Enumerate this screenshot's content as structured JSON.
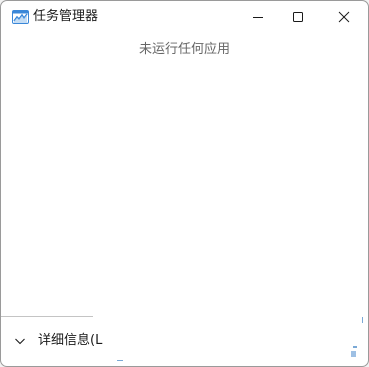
{
  "window": {
    "title": "任务管理器",
    "app_icon": "task-manager-icon"
  },
  "caption_buttons": {
    "minimize_icon": "minimize-icon",
    "maximize_icon": "maximize-icon",
    "close_icon": "close-icon"
  },
  "main": {
    "empty_message": "未运行任何应用"
  },
  "footer": {
    "details_label": "详细信息(L",
    "chevron_icon": "chevron-down-icon"
  },
  "colors": {
    "accent": "#1e76d3",
    "text": "#1a1a1a",
    "muted_text": "#666666"
  }
}
